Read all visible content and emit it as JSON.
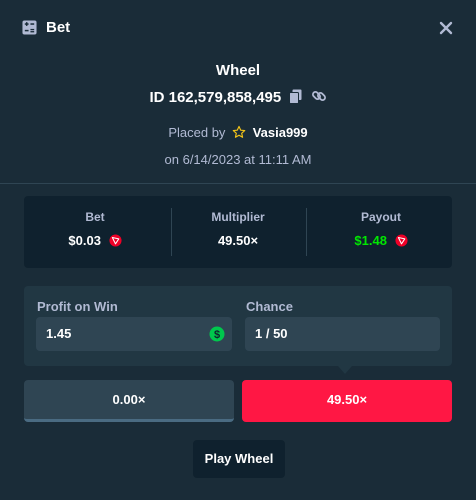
{
  "header": {
    "title": "Bet",
    "close_icon": "close-icon"
  },
  "bet": {
    "game": "Wheel",
    "id": "ID 162,579,858,495",
    "placed_by_prefix": "Placed by",
    "username": "Vasia999",
    "date": "on 6/14/2023 at 11:11 AM"
  },
  "summary": {
    "bet_label": "Bet",
    "bet_value": "$0.03",
    "multiplier_label": "Multiplier",
    "multiplier_value": "49.50×",
    "payout_label": "Payout",
    "payout_value": "$1.48"
  },
  "details": {
    "profit_label": "Profit on Win",
    "profit_value": "1.45",
    "chance_label": "Chance",
    "chance_value": "1 / 50"
  },
  "segments": {
    "low": "0.00×",
    "high": "49.50×"
  },
  "play_button": "Play Wheel",
  "colors": {
    "background": "#1a2c38",
    "panel": "#0f212e",
    "accent_red": "#ff1744",
    "payout_green": "#00e701",
    "muted_text": "#b1bad3"
  }
}
